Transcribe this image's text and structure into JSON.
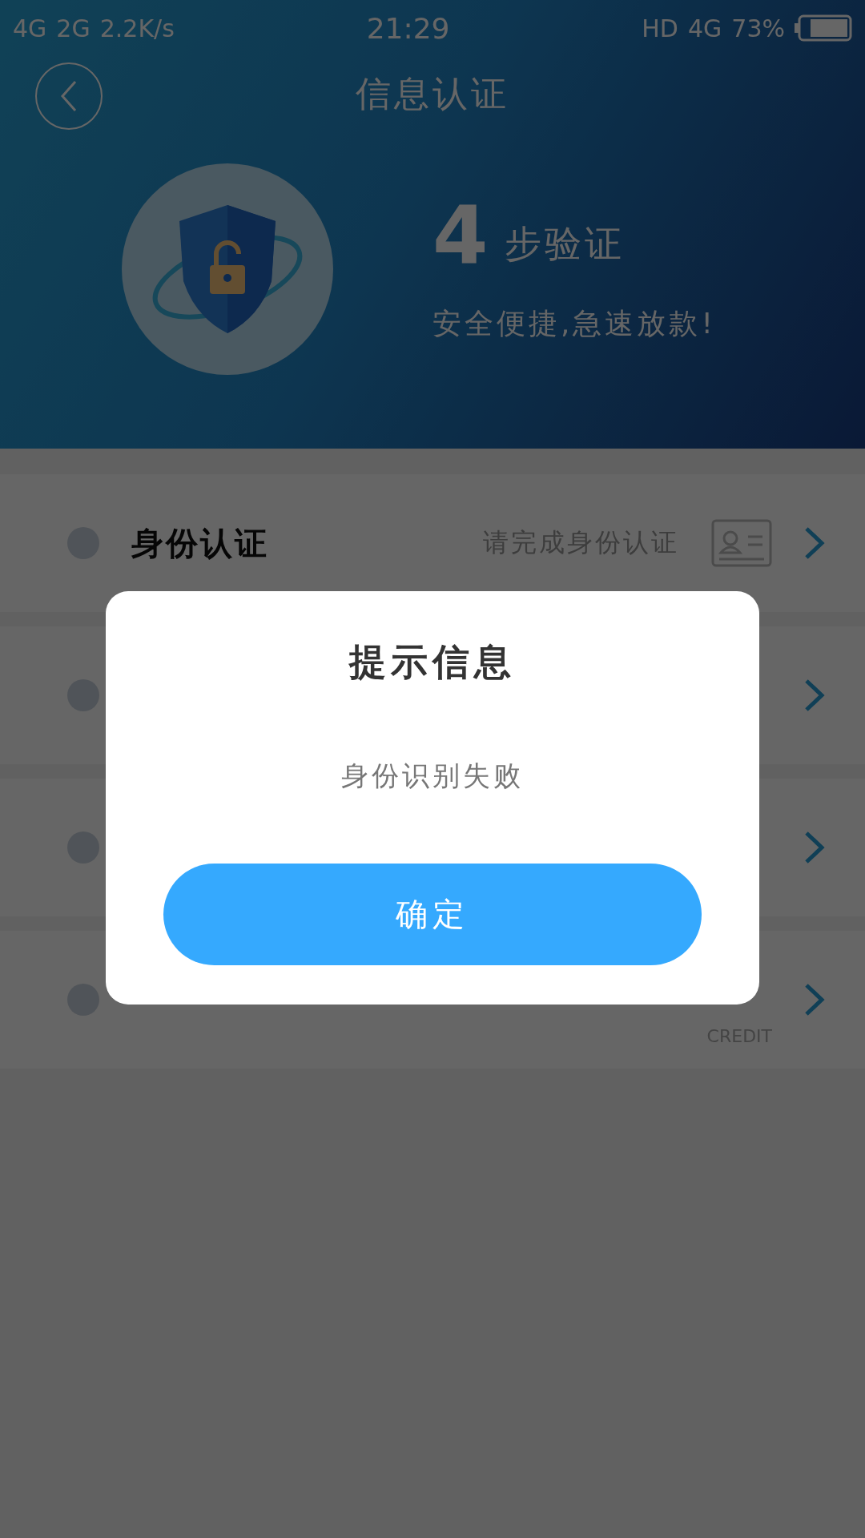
{
  "status_bar": {
    "network_1": "4G",
    "network_2": "2G",
    "speed": "2.2K/s",
    "time": "21:29",
    "hd": "HD",
    "network_3": "4G",
    "battery": "73%"
  },
  "header": {
    "title": "信息认证",
    "step_count": "4",
    "step_label": "步验证",
    "slogan": "安全便捷,急速放款!"
  },
  "rows": [
    {
      "kind": "id",
      "title": "身份认证",
      "hint": "请完成身份认证"
    },
    {
      "kind": "hidden"
    },
    {
      "kind": "hidden"
    },
    {
      "kind": "credit",
      "caption": "CREDIT"
    }
  ],
  "dialog": {
    "title": "提示信息",
    "message": "身份识别失败",
    "button": "确定"
  }
}
